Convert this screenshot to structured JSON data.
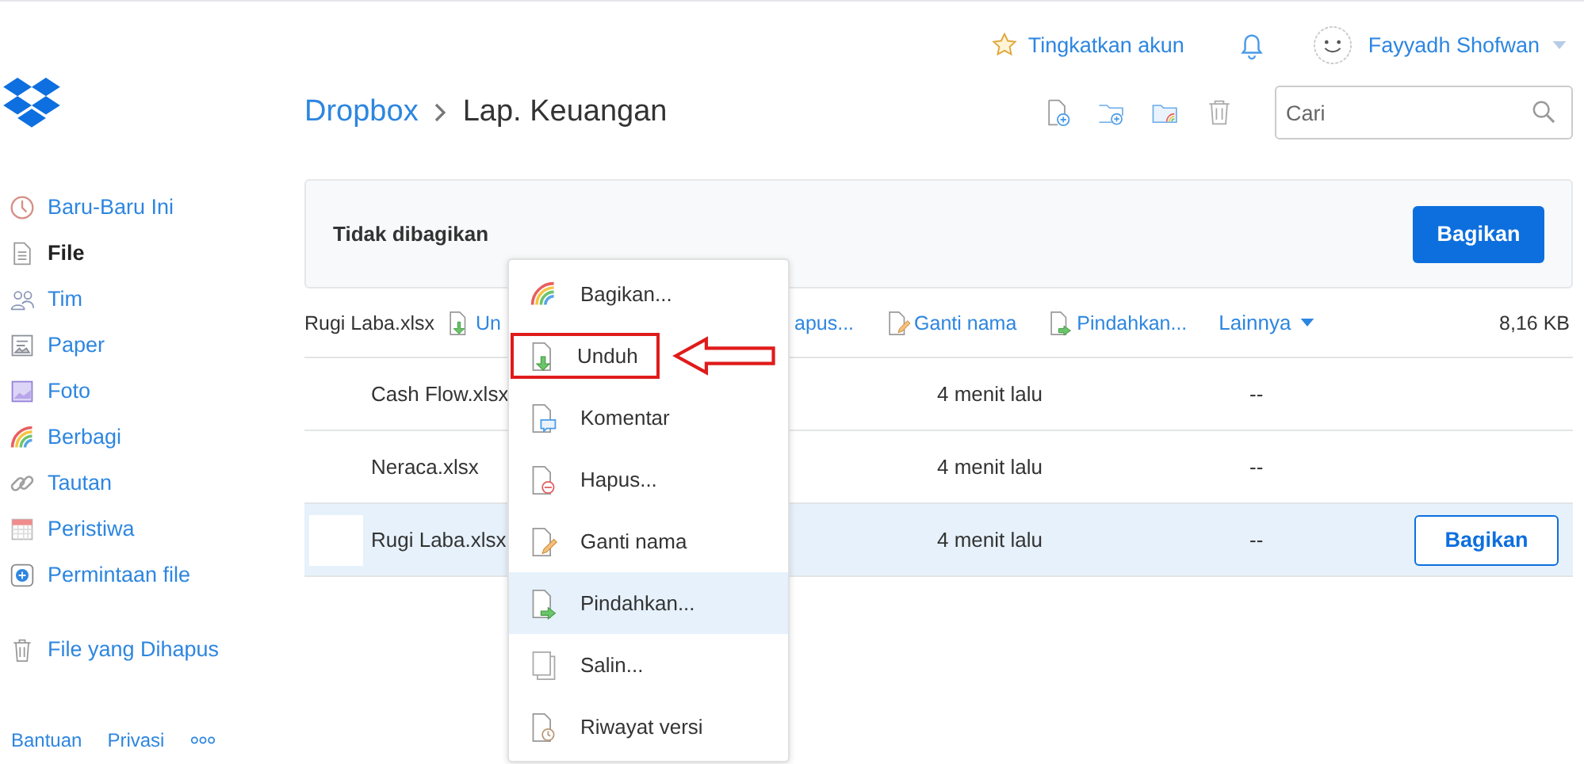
{
  "header": {
    "upgrade": "Tingkatkan akun",
    "user": "Fayyadh Shofwan"
  },
  "sidebar": {
    "items": [
      {
        "label": "Baru-Baru Ini",
        "kind": "recent",
        "selected": false
      },
      {
        "label": "File",
        "kind": "file",
        "selected": true
      },
      {
        "label": "Tim",
        "kind": "team",
        "selected": false
      },
      {
        "label": "Paper",
        "kind": "paper",
        "selected": false
      },
      {
        "label": "Foto",
        "kind": "photo",
        "selected": false
      },
      {
        "label": "Berbagi",
        "kind": "share",
        "selected": false
      },
      {
        "label": "Tautan",
        "kind": "link",
        "selected": false
      },
      {
        "label": "Peristiwa",
        "kind": "event",
        "selected": false
      },
      {
        "label": "Permintaan file",
        "kind": "request",
        "selected": false
      }
    ],
    "deleted": "File yang Dihapus",
    "footer": [
      "Bantuan",
      "Privasi"
    ]
  },
  "breadcrumb": [
    "Dropbox",
    "Lap. Keuangan"
  ],
  "search": {
    "placeholder": "Cari"
  },
  "share_banner": {
    "text": "Tidak dibagikan",
    "button": "Bagikan"
  },
  "action_bar": {
    "file": "Rugi Laba.xlsx",
    "actions": [
      {
        "label": "Un",
        "kind": "download"
      },
      {
        "label": "apus..."
      },
      {
        "label": "Ganti nama",
        "kind": "rename"
      },
      {
        "label": "Pindahkan...",
        "kind": "move"
      }
    ],
    "more": "Lainnya",
    "size": "8,16 KB"
  },
  "files": [
    {
      "name": "Cash Flow.xlsx",
      "modified": "4 menit lalu",
      "members": "--",
      "selected": false
    },
    {
      "name": "Neraca.xlsx",
      "modified": "4 menit lalu",
      "members": "--",
      "selected": false
    },
    {
      "name": "Rugi Laba.xlsx",
      "modified": "4 menit lalu",
      "members": "--",
      "selected": true,
      "button": "Bagikan"
    }
  ],
  "context_menu": [
    {
      "label": "Bagikan...",
      "kind": "share",
      "selected": false,
      "highlighted": false
    },
    {
      "label": "Unduh",
      "kind": "download",
      "selected": false,
      "highlighted": true
    },
    {
      "label": "Komentar",
      "kind": "comment",
      "selected": false,
      "highlighted": false
    },
    {
      "label": "Hapus...",
      "kind": "delete",
      "selected": false,
      "highlighted": false
    },
    {
      "label": "Ganti nama",
      "kind": "rename",
      "selected": false,
      "highlighted": false
    },
    {
      "label": "Pindahkan...",
      "kind": "move",
      "selected": true,
      "highlighted": false
    },
    {
      "label": "Salin...",
      "kind": "copy",
      "selected": false,
      "highlighted": false
    },
    {
      "label": "Riwayat versi",
      "kind": "history",
      "selected": false,
      "highlighted": false
    }
  ]
}
